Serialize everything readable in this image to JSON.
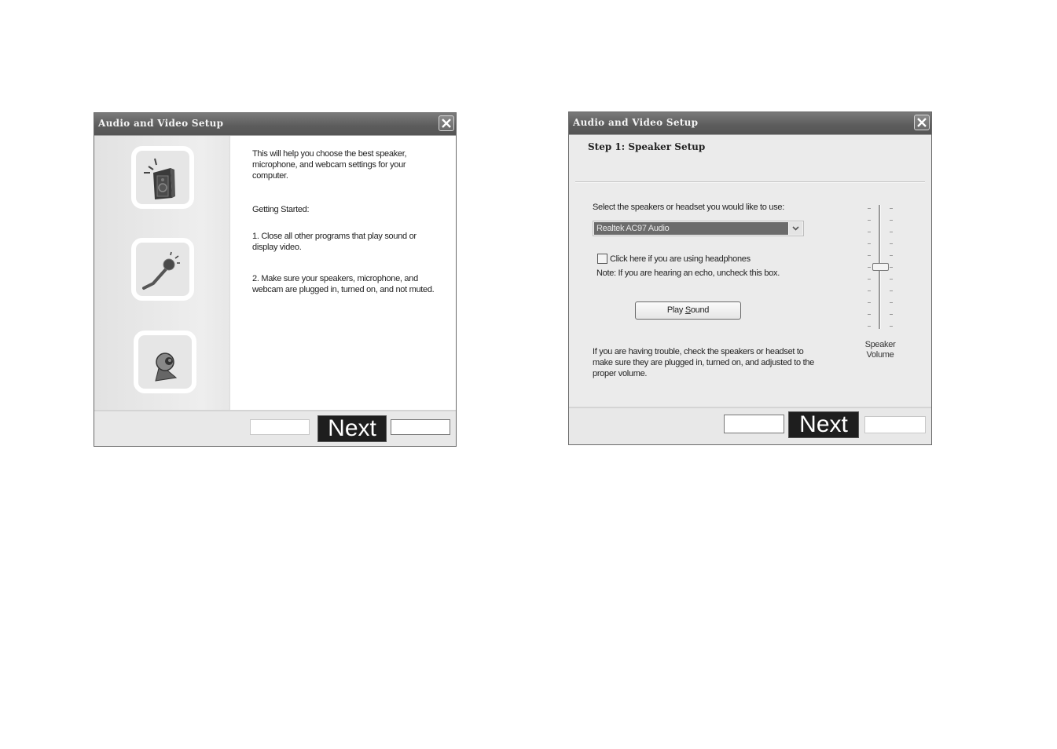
{
  "dialogs": [
    {
      "title": "Audio and Video Setup",
      "icons": [
        "speaker-icon",
        "microphone-icon",
        "webcam-icon"
      ],
      "intro": "This will help you choose the best speaker, microphone, and webcam settings for your computer.",
      "getting_started": "Getting Started:",
      "step1": "1. Close all other programs that play sound or display video.",
      "step2": "2. Make sure your speakers, microphone, and webcam are plugged in, turned on, and not muted.",
      "footer": {
        "back_label": "",
        "next_label": "Next",
        "cancel_label": ""
      }
    },
    {
      "title": "Audio and Video Setup",
      "step_title": "Step 1: Speaker Setup",
      "select_label": "Select the speakers or headset you would like to use:",
      "select_value": "Realtek AC97 Audio",
      "headphones_checkbox_label": "Click here if you are using headphones",
      "headphones_checked": false,
      "echo_note": "Note: If you are hearing an echo, uncheck this box.",
      "play_sound_label": "Play Sound",
      "play_sound_prefix": "Play ",
      "play_sound_accel": "S",
      "play_sound_suffix": "ound",
      "trouble_text": "If you are having trouble, check the speakers or headset to make sure they are plugged in, turned on, and adjusted to the proper volume.",
      "volume_label_line1": "Speaker",
      "volume_label_line2": "Volume",
      "volume_percent": 50,
      "volume_ticks": 11,
      "footer": {
        "back_label": "",
        "next_label": "Next",
        "cancel_label": ""
      }
    }
  ]
}
